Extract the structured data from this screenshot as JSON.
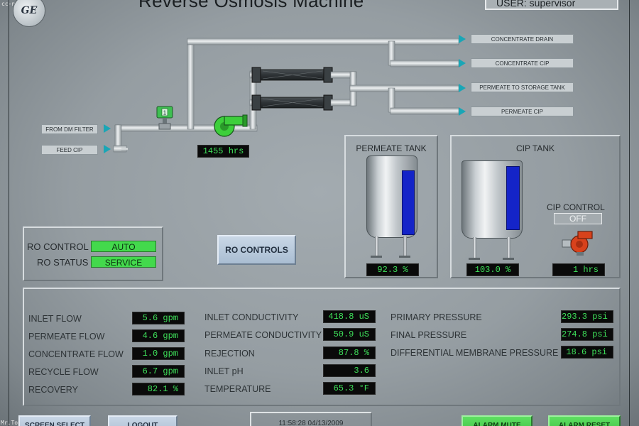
{
  "watermark": {
    "top": "cc-nc-nd",
    "bottom": "Mr.Topher"
  },
  "header": {
    "title": "Reverse Osmosis Machine",
    "user": "USER:   supervisor",
    "logo": "GE"
  },
  "destinations": {
    "concentrate_drain": "CONCENTRATE DRAIN",
    "concentrate_cip": "CONCENTRATE CIP",
    "permeate_storage": "PERMEATE TO STORAGE TANK",
    "permeate_cip": "PERMEATE CIP"
  },
  "sources": {
    "from_dm_filter": "FROM DM FILTER",
    "feed_cip": "FEED CIP"
  },
  "pump": {
    "hours": "1455   hrs",
    "valve_label": "1"
  },
  "permeate_tank": {
    "title": "PERMEATE TANK",
    "level_text": "92.3  %",
    "level": 0.923
  },
  "cip_tank": {
    "title": "CIP TANK",
    "level_text": "103.0 %",
    "level": 1.0,
    "control_label": "CIP CONTROL",
    "control_value": "OFF",
    "pump_hours": "1      hrs"
  },
  "ro": {
    "control_label": "RO CONTROL",
    "control_value": "AUTO",
    "status_label": "RO STATUS",
    "status_value": "SERVICE",
    "controls_button": "RO CONTROLS"
  },
  "params": {
    "col1": [
      {
        "label": "INLET FLOW",
        "value": "5.6   gpm"
      },
      {
        "label": "PERMEATE FLOW",
        "value": "4.6   gpm"
      },
      {
        "label": "CONCENTRATE FLOW",
        "value": "1.0   gpm"
      },
      {
        "label": "RECYCLE FLOW",
        "value": "6.7   gpm"
      },
      {
        "label": "RECOVERY",
        "value": "82.1  %"
      }
    ],
    "col2": [
      {
        "label": "INLET CONDUCTIVITY",
        "value": "418.8 uS"
      },
      {
        "label": "PERMEATE CONDUCTIVITY",
        "value": "50.9  uS"
      },
      {
        "label": "REJECTION",
        "value": "87.8  %"
      },
      {
        "label": "INLET pH",
        "value": "3.6"
      },
      {
        "label": "TEMPERATURE",
        "value": "65.3  °F"
      }
    ],
    "col3": [
      {
        "label": "PRIMARY PRESSURE",
        "value": "293.3 psi"
      },
      {
        "label": "FINAL PRESSURE",
        "value": "274.8 psi"
      },
      {
        "label": "DIFFERENTIAL MEMBRANE PRESSURE",
        "value": "18.6  psi"
      }
    ]
  },
  "footer": {
    "screen_select": "SCREEN SELECT",
    "logout": "LOGOUT",
    "datetime": "11:58:28    04/13/2009",
    "alarm_mute": "ALARM MUTE",
    "alarm_reset": "ALARM RESET"
  },
  "colors": {
    "lcd_text": "#3ee05a",
    "level_fill": "#1424c8",
    "pipe": "#c8ced2",
    "accent_arrow": "#1aa6b6",
    "status_green": "#43d94c"
  }
}
